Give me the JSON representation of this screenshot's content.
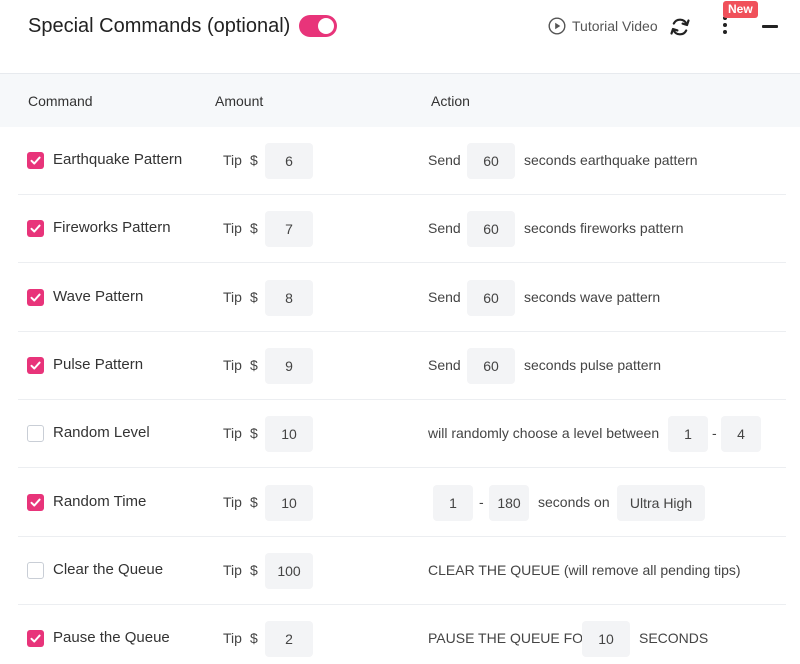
{
  "header": {
    "title": "Special Commands (optional)",
    "tutorial_label": "Tutorial Video",
    "new_badge": "New"
  },
  "colors": {
    "accent": "#e8347a",
    "badge": "#f0505a"
  },
  "table": {
    "headers": {
      "command": "Command",
      "amount": "Amount",
      "action": "Action"
    },
    "tip_label": "Tip",
    "currency": "$",
    "dash": "-",
    "rows": [
      {
        "checked": true,
        "name": "Earthquake Pattern",
        "amount": "6",
        "send": "Send",
        "duration": "60",
        "suffix": "seconds earthquake pattern"
      },
      {
        "checked": true,
        "name": "Fireworks Pattern",
        "amount": "7",
        "send": "Send",
        "duration": "60",
        "suffix": "seconds fireworks pattern"
      },
      {
        "checked": true,
        "name": "Wave Pattern",
        "amount": "8",
        "send": "Send",
        "duration": "60",
        "suffix": "seconds wave pattern"
      },
      {
        "checked": true,
        "name": "Pulse Pattern",
        "amount": "9",
        "send": "Send",
        "duration": "60",
        "suffix": "seconds pulse pattern"
      },
      {
        "checked": false,
        "name": "Random Level",
        "amount": "10",
        "text": "will randomly choose a level between",
        "min": "1",
        "max": "4"
      },
      {
        "checked": true,
        "name": "Random Time",
        "amount": "10",
        "min": "1",
        "max": "180",
        "text": "seconds on",
        "level": "Ultra High"
      },
      {
        "checked": false,
        "name": "Clear the Queue",
        "amount": "100",
        "text": "CLEAR THE QUEUE (will remove all pending tips)"
      },
      {
        "checked": true,
        "name": "Pause the Queue",
        "amount": "2",
        "prefix": "PAUSE THE QUEUE FOR",
        "duration": "10",
        "suffix": "SECONDS"
      }
    ]
  }
}
